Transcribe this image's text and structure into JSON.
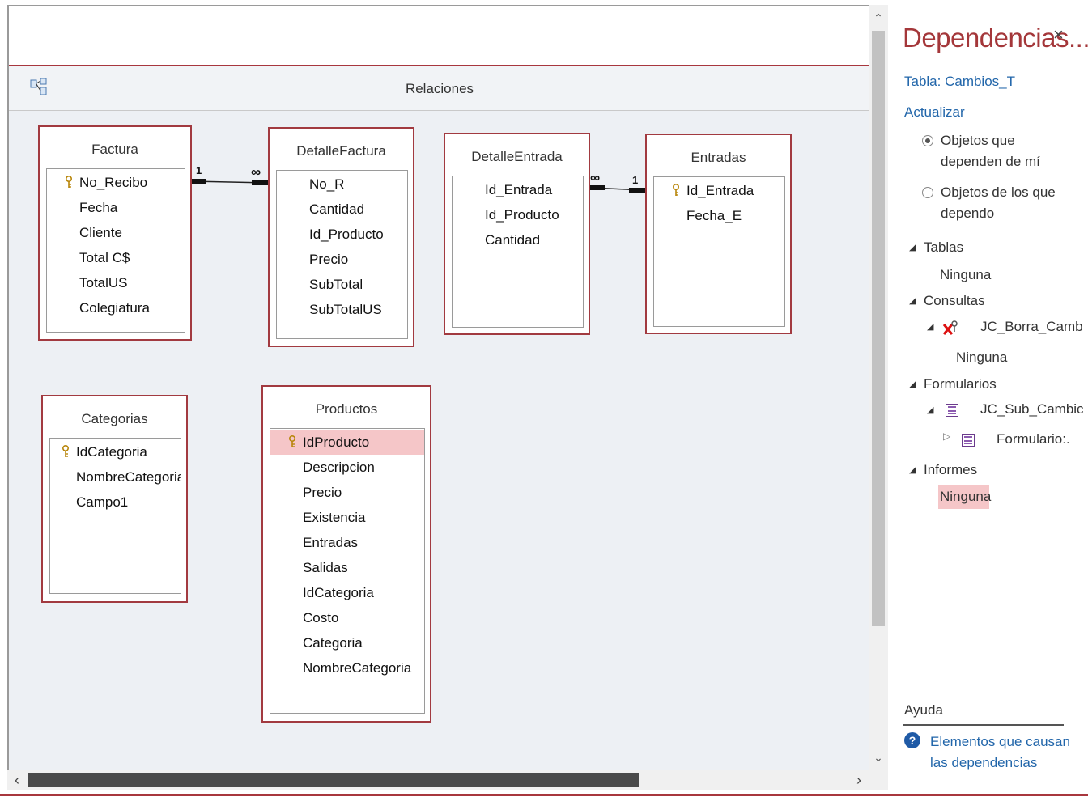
{
  "relations_window": {
    "title": "Relaciones"
  },
  "tables": {
    "factura": {
      "title": "Factura",
      "fields": [
        "No_Recibo",
        "Fecha",
        "Cliente",
        "Total C$",
        "TotalUS",
        "Colegiatura"
      ],
      "key_field": "No_Recibo"
    },
    "detalle_factura": {
      "title": "DetalleFactura",
      "fields": [
        "No_R",
        "Cantidad",
        "Id_Producto",
        "Precio",
        "SubTotal",
        "SubTotalUS"
      ]
    },
    "detalle_entrada": {
      "title": "DetalleEntrada",
      "fields": [
        "Id_Entrada",
        "Id_Producto",
        "Cantidad"
      ]
    },
    "entradas": {
      "title": "Entradas",
      "fields": [
        "Id_Entrada",
        "Fecha_E"
      ],
      "key_field": "Id_Entrada"
    },
    "categorias": {
      "title": "Categorias",
      "fields": [
        "IdCategoria",
        "NombreCategoria",
        "Campo1"
      ],
      "key_field": "IdCategoria"
    },
    "productos": {
      "title": "Productos",
      "fields": [
        "IdProducto",
        "Descripcion",
        "Precio",
        "Existencia",
        "Entradas",
        "Salidas",
        "IdCategoria",
        "Costo",
        "Categoria",
        "NombreCategoria"
      ],
      "key_field": "IdProducto",
      "selected_field": "IdProducto"
    }
  },
  "relationships": [
    {
      "from": "Factura",
      "to": "DetalleFactura",
      "one_label": "1",
      "many_label": "∞"
    },
    {
      "from": "Entradas",
      "to": "DetalleEntrada",
      "one_label": "1",
      "many_label": "∞"
    }
  ],
  "dependencies_pane": {
    "title": "Dependencias...",
    "close_glyph": "×",
    "table_label": "Tabla: Cambios_T",
    "refresh_label": "Actualizar",
    "radio_option_1_line1": "Objetos que",
    "radio_option_1_line2": "dependen de mí",
    "radio_option_2_line1": "Objetos de los que",
    "radio_option_2_line2": "dependo",
    "selected_option": "Objetos que dependen de mí",
    "sections": {
      "tablas": {
        "label": "Tablas",
        "value": "Ninguna"
      },
      "consultas": {
        "label": "Consultas",
        "item": "JC_Borra_Camb",
        "item_value": "Ninguna"
      },
      "formularios": {
        "label": "Formularios",
        "item": "JC_Sub_Cambic",
        "subitem": "Formulario:."
      },
      "informes": {
        "label": "Informes",
        "value": "Ninguna"
      }
    },
    "help_title": "Ayuda",
    "help_link_line1": "Elementos que causan",
    "help_link_line2": "las dependencias"
  },
  "colors": {
    "accent": "#a8373e",
    "link": "#2266aa",
    "selection": "#f5c6c8",
    "canvas": "#edf0f4"
  }
}
